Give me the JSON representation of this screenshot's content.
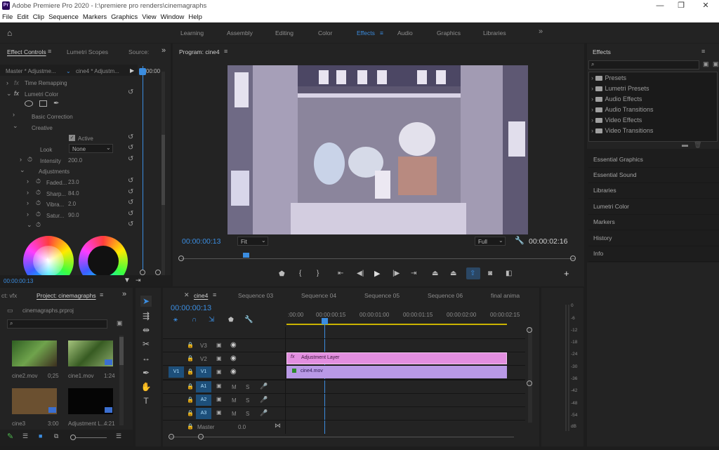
{
  "window": {
    "title": "Adobe Premiere Pro 2020 - I:\\premiere pro renders\\cinemagraphs",
    "logo": "Pr"
  },
  "menu": [
    "File",
    "Edit",
    "Clip",
    "Sequence",
    "Markers",
    "Graphics",
    "View",
    "Window",
    "Help"
  ],
  "workspaces": [
    "Learning",
    "Assembly",
    "Editing",
    "Color",
    "Effects",
    "Audio",
    "Graphics",
    "Libraries"
  ],
  "workspace_active": "Effects",
  "effect_controls": {
    "tabs": [
      "Effect Controls",
      "Lumetri Scopes",
      "Source:"
    ],
    "master": "Master * Adjustme...",
    "clip": "cine4 * Adjustm...",
    "time_marker": "00:00",
    "time_remapping": "Time Remapping",
    "lumetri": "Lumetri Color",
    "basic": "Basic Correction",
    "creative": "Creative",
    "active_label": "Active",
    "look_label": "Look",
    "look_value": "None",
    "intensity_label": "Intensity",
    "intensity_value": "200.0",
    "adjustments": "Adjustments",
    "params": [
      {
        "label": "Faded...",
        "value": "23.0"
      },
      {
        "label": "Sharp...",
        "value": "84.0"
      },
      {
        "label": "Vibra...",
        "value": "2.0"
      },
      {
        "label": "Satur...",
        "value": "90.0"
      }
    ],
    "timecode": "00:00:00:13"
  },
  "program": {
    "title": "Program: cine4",
    "timecode": "00:00:00:13",
    "fit": "Fit",
    "quality": "Full",
    "duration": "00:00:02:16"
  },
  "effects_panel": {
    "title": "Effects",
    "items": [
      "Presets",
      "Lumetri Presets",
      "Audio Effects",
      "Audio Transitions",
      "Video Effects",
      "Video Transitions"
    ]
  },
  "right_panels": [
    "Essential Graphics",
    "Essential Sound",
    "Libraries",
    "Lumetri Color",
    "Markers",
    "History",
    "Info"
  ],
  "project": {
    "tabs": [
      "ct: vfx",
      "Project: cinemagraphs"
    ],
    "file": "cinemagraphs.prproj",
    "clips": [
      {
        "name": "cine2.mov",
        "dur": "0;25"
      },
      {
        "name": "cine1.mov",
        "dur": "1:24"
      },
      {
        "name": "cine3",
        "dur": "3:00"
      },
      {
        "name": "Adjustment L...",
        "dur": "4:21"
      }
    ]
  },
  "timeline": {
    "tabs": [
      "cine4",
      "Sequence 03",
      "Sequence 04",
      "Sequence 05",
      "Sequence 06",
      "final anima"
    ],
    "timecode": "00:00:00:13",
    "ruler": [
      ":00:00",
      "00:00:00:15",
      "00:00:01:00",
      "00:00:01:15",
      "00:00:02:00",
      "00:00:02:15"
    ],
    "video_tracks": [
      "V3",
      "V2",
      "V1"
    ],
    "audio_tracks": [
      "A1",
      "A2",
      "A3"
    ],
    "source_v": "V1",
    "clip_adjustment": "Adjustment Layer",
    "clip_video": "cine4.mov",
    "master_label": "Master",
    "master_value": "0.0",
    "mute": "M",
    "solo": "S"
  },
  "audio_meter": {
    "scale": [
      "0",
      "-6",
      "-12",
      "-18",
      "-24",
      "-30",
      "-36",
      "-42",
      "-48",
      "-54",
      "dB"
    ]
  },
  "colors": {
    "accent": "#3b8de0",
    "adjustment": "#e38fe0",
    "video": "#b999e6",
    "track_blue": "#1d4f7a"
  }
}
